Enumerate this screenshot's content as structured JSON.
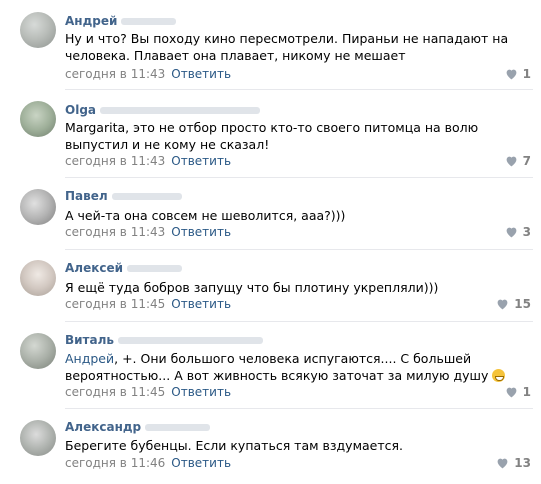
{
  "comments": [
    {
      "author": "Андрей",
      "text": "Ну и что? Вы походу кино пересмотрели. Пираньи не нападают на человека. Плавает она плавает, никому не мешает",
      "time": "сегодня в 11:43",
      "reply": "Ответить",
      "likes": "1"
    },
    {
      "author": "Olga",
      "text": "Margarita, это не отбор просто кто-то своего питомца на волю выпустил и не кому не сказал!",
      "time": "сегодня в 11:43",
      "reply": "Ответить",
      "likes": "7"
    },
    {
      "author": "Павел",
      "text": "А чей-та она совсем не шеволится, ааа?)))",
      "time": "сегодня в 11:43",
      "reply": "Ответить",
      "likes": "3"
    },
    {
      "author": "Алексей",
      "text": "Я ещё туда бобров запущу что бы плотину укрепляли)))",
      "time": "сегодня в 11:45",
      "reply": "Ответить",
      "likes": "15"
    },
    {
      "author": "Виталь",
      "mention": "Андрей",
      "text": ", +. Они большого человека испугаются.... С большей вероятностью... А вот живность всякую заточат за милую душу",
      "time": "сегодня в 11:45",
      "reply": "Ответить",
      "likes": "1",
      "emoji": "grin-emoji"
    },
    {
      "author": "Александр",
      "text": "Берегите бубенцы. Если купаться там вздумается.",
      "time": "сегодня в 11:46",
      "reply": "Ответить",
      "likes": "13"
    }
  ],
  "icons": {
    "like": "heart-icon"
  },
  "colors": {
    "author": "#42648b",
    "link": "#2a5885",
    "meta": "#828282",
    "divider": "#e7e8ec"
  }
}
